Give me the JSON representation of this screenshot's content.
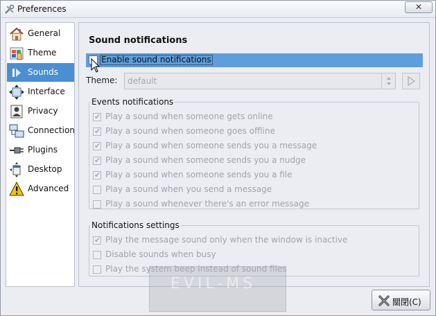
{
  "window": {
    "title": "Preferences",
    "close_glyph": "✕"
  },
  "sidebar": {
    "items": [
      {
        "label": "General",
        "icon": "home-icon"
      },
      {
        "label": "Theme",
        "icon": "theme-icon"
      },
      {
        "label": "Sounds",
        "icon": "sounds-icon",
        "selected": true
      },
      {
        "label": "Interface",
        "icon": "interface-icon"
      },
      {
        "label": "Privacy",
        "icon": "privacy-icon"
      },
      {
        "label": "Connection",
        "icon": "connection-icon"
      },
      {
        "label": "Plugins",
        "icon": "plugins-icon"
      },
      {
        "label": "Desktop",
        "icon": "desktop-icon"
      },
      {
        "label": "Advanced",
        "icon": "warning-icon"
      }
    ]
  },
  "sounds": {
    "title": "Sound notifications",
    "enable_label": "Enable sound notifications",
    "enable_checked": false,
    "theme_label": "Theme:",
    "theme_value": "default"
  },
  "events_group": {
    "legend": "Events notifications",
    "options": [
      {
        "label": "Play a sound when someone gets online",
        "checked": true
      },
      {
        "label": "Play a sound when someone goes offline",
        "checked": true
      },
      {
        "label": "Play a sound when someone sends you a message",
        "checked": true
      },
      {
        "label": "Play a sound when someone sends you a nudge",
        "checked": true
      },
      {
        "label": "Play a sound when someone sends you a file",
        "checked": true
      },
      {
        "label": "Play a sound when you send a message",
        "checked": false
      },
      {
        "label": "Play a sound whenever there's an error message",
        "checked": false
      }
    ]
  },
  "settings_group": {
    "legend": "Notifications settings",
    "options": [
      {
        "label": "Play the message sound only when the window is inactive",
        "checked": true
      },
      {
        "label": "Disable sounds when busy",
        "checked": false
      },
      {
        "label": "Play the system beep instead of sound files",
        "checked": false
      }
    ]
  },
  "footer": {
    "close_label": "關閉(C)"
  },
  "watermark": {
    "text": "EVIL-MS"
  },
  "colors": {
    "selection": "#4b8fd0",
    "highlight_row": "#5e9edc",
    "disabled_text": "#a0a3a9"
  }
}
